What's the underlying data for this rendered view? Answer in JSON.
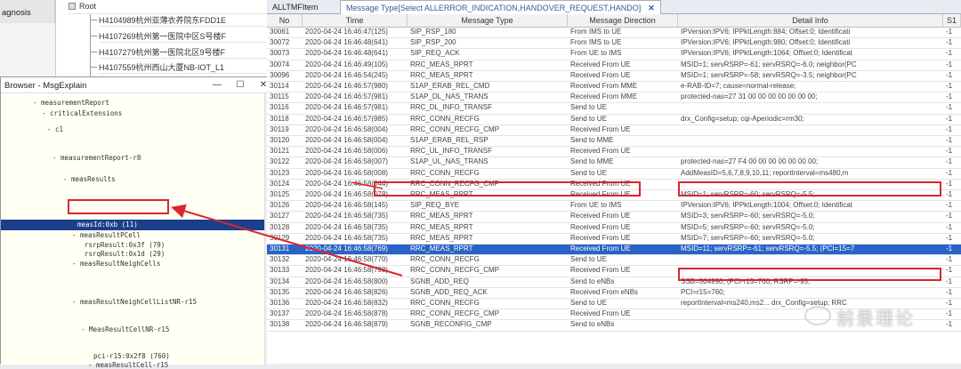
{
  "left_pane": {
    "diagnosis_label": "agnosis",
    "root_label": "Root",
    "tree_items": [
      "H4104989杭州亚薄衣养院东FDD1E",
      "H4107269杭州第一医院中区S号楼F",
      "H4107279杭州第一医院北区9号楼F",
      "H4107559杭州西山大厦NB-IOT_L1"
    ]
  },
  "browser": {
    "title": "Browser - MsgExplain",
    "minimize": "—",
    "maximize": "☐",
    "close": "✕",
    "nodes": [
      "- measurementReport",
      "- criticalExtensions",
      "- c1",
      "- measurementReport-r8",
      "- measResults",
      "measId:0xb (11)",
      "- measResultPCell",
      "rsrpResult:0x3f (79)",
      "rsrqResult:0x1d (29)",
      "- measResultNeighCells",
      "- measResultNeighCellListNR-r15",
      "- MeasResultCellNR-r15",
      "pci-r15:0x2f8 (760)",
      "- measResultCell-r15"
    ]
  },
  "messages": {
    "tab_all": "ALLTMFItem",
    "tab_filter": "Message Type[Select ALLERROR_INDICATION,HANDOVER_REQUEST,HANDO]",
    "tab_close": "✕",
    "columns": [
      "No",
      "Time",
      "Message Type",
      "Message Direction",
      "Detail Info",
      "S1"
    ],
    "rows": [
      [
        "30061",
        "2020-04-24 16:46:47(125)",
        "SIP_RSP_180",
        "From IMS to UE",
        "IPVersion:IPV6; IPPktLength:884; Offset:0; Identificati",
        "-1"
      ],
      [
        "30072",
        "2020-04-24 16:46:48(641)",
        "SIP_RSP_200",
        "From IMS to UE",
        "IPVersion:IPV6; IPPktLength:980; Offset:0; Identificati",
        "-1"
      ],
      [
        "30073",
        "2020-04-24 16:46:48(641)",
        "SIP_REQ_ACK",
        "From UE to IMS",
        "IPVersion:IPV6; IPPktLength:1064; Offset:0; Identificat",
        "-1"
      ],
      [
        "30074",
        "2020-04-24 16:46:49(105)",
        "RRC_MEAS_RPRT",
        "Received From UE",
        "MSID=1; servRSRP=-61; servRSRQ=-6.0; neighbor(PC",
        "-1"
      ],
      [
        "30096",
        "2020-04-24 16:46:54(245)",
        "RRC_MEAS_RPRT",
        "Received From UE",
        "MSID=1; servRSRP=-58; servRSRQ=-3.5; neighbor(PC",
        "-1"
      ],
      [
        "30114",
        "2020-04-24 16:46:57(980)",
        "S1AP_ERAB_REL_CMD",
        "Received From MME",
        "e-RAB-ID=7; cause=normal-release;",
        "-1"
      ],
      [
        "30115",
        "2020-04-24 16:46:57(981)",
        "S1AP_DL_NAS_TRANS",
        "Received From MME",
        "protected-nas=27 31 00 00 00 00 00 00 00;",
        "-1"
      ],
      [
        "30116",
        "2020-04-24 16:46:57(981)",
        "RRC_DL_INFO_TRANSF",
        "Send to UE",
        "",
        "-1"
      ],
      [
        "30118",
        "2020-04-24 16:46:57(985)",
        "RRC_CONN_RECFG",
        "Send to UE",
        "drx_Config=setup; cqi-Aperiodic=rm30;",
        "-1"
      ],
      [
        "30119",
        "2020-04-24 16:46:58(004)",
        "RRC_CONN_RECFG_CMP",
        "Received From UE",
        "",
        "-1"
      ],
      [
        "30120",
        "2020-04-24 16:46:58(004)",
        "S1AP_ERAB_REL_RSP",
        "Send to MME",
        "",
        "-1"
      ],
      [
        "30121",
        "2020-04-24 16:46:58(006)",
        "RRC_UL_INFO_TRANSF",
        "Received From UE",
        "",
        "-1"
      ],
      [
        "30122",
        "2020-04-24 16:46:58(007)",
        "S1AP_UL_NAS_TRANS",
        "Send to MME",
        "protected-nas=27 F4 00 00 00 00 00 00 00;",
        "-1"
      ],
      [
        "30123",
        "2020-04-24 16:46:58(008)",
        "RRC_CONN_RECFG",
        "Send to UE",
        "AddMeasID=5,6,7,8,9,10,11; reportInterval=ms480,m",
        "-1"
      ],
      [
        "30124",
        "2020-04-24 16:46:58(044)",
        "RRC_CONN_RECFG_CMP",
        "Received From UE",
        "",
        "-1"
      ],
      [
        "30125",
        "2020-04-24 16:46:58(078)",
        "RRC_MEAS_RPRT",
        "Received From UE",
        "MSID=1; servRSRP=-60; servRSRQ=-5.5;",
        "-1"
      ],
      [
        "30126",
        "2020-04-24 16:46:58(145)",
        "SIP_REQ_BYE",
        "From UE to IMS",
        "IPVersion:IPV6; IPPktLength:1004; Offset:0; Identificat",
        "-1"
      ],
      [
        "30127",
        "2020-04-24 16:46:58(735)",
        "RRC_MEAS_RPRT",
        "Received From UE",
        "MSID=3; servRSRP=-60; servRSRQ=-5.0;",
        "-1"
      ],
      [
        "30128",
        "2020-04-24 16:46:58(735)",
        "RRC_MEAS_RPRT",
        "Received From UE",
        "MSID=5; servRSRP=-60; servRSRQ=-5.0;",
        "-1"
      ],
      [
        "30129",
        "2020-04-24 16:46:58(735)",
        "RRC_MEAS_RPRT",
        "Received From UE",
        "MSID=7; servRSRP=-60; servRSRQ=-5.0;",
        "-1"
      ],
      [
        "30131",
        "2020-04-24 16:46:58(769)",
        "RRC_MEAS_RPRT",
        "Received From UE",
        "MSID=11; servRSRP=-61; servRSRQ=-5.5; (PCI=15=7",
        "-1"
      ],
      [
        "30132",
        "2020-04-24 16:46:58(770)",
        "RRC_CONN_RECFG",
        "Send to UE",
        "",
        "-1"
      ],
      [
        "30133",
        "2020-04-24 16:46:58(798)",
        "RRC_CONN_RECFG_CMP",
        "Received From UE",
        "",
        "-1"
      ],
      [
        "30134",
        "2020-04-24 16:46:58(800)",
        "SGNB_ADD_REQ",
        "Send to eNBs",
        "SSB=504990; (PCI-r15=760; RSRP=-95;",
        "-1"
      ],
      [
        "30135",
        "2020-04-24 16:46:58(826)",
        "SGNB_ADD_REQ_ACK",
        "Received From eNBs",
        "PCI=r15=760;",
        "-1"
      ],
      [
        "30136",
        "2020-04-24 16:46:58(832)",
        "RRC_CONN_RECFG",
        "Send to UE",
        "reportInterval=ms240,ms2... drx_Config=setup; RRC",
        "-1"
      ],
      [
        "30137",
        "2020-04-24 16:46:58(878)",
        "RRC_CONN_RECFG_CMP",
        "Received From UE",
        "",
        "-1"
      ],
      [
        "30138",
        "2020-04-24 16:46:58(879)",
        "SGNB_RECONFIG_CMP",
        "Send to eNBs",
        "",
        "-1"
      ]
    ],
    "selected_row": 20
  },
  "watermark": {
    "text": "前景理论"
  },
  "colors": {
    "highlight_red": "#d9262c",
    "selection_blue": "#2a63c7",
    "tree_selection": "#1c3f8c"
  }
}
